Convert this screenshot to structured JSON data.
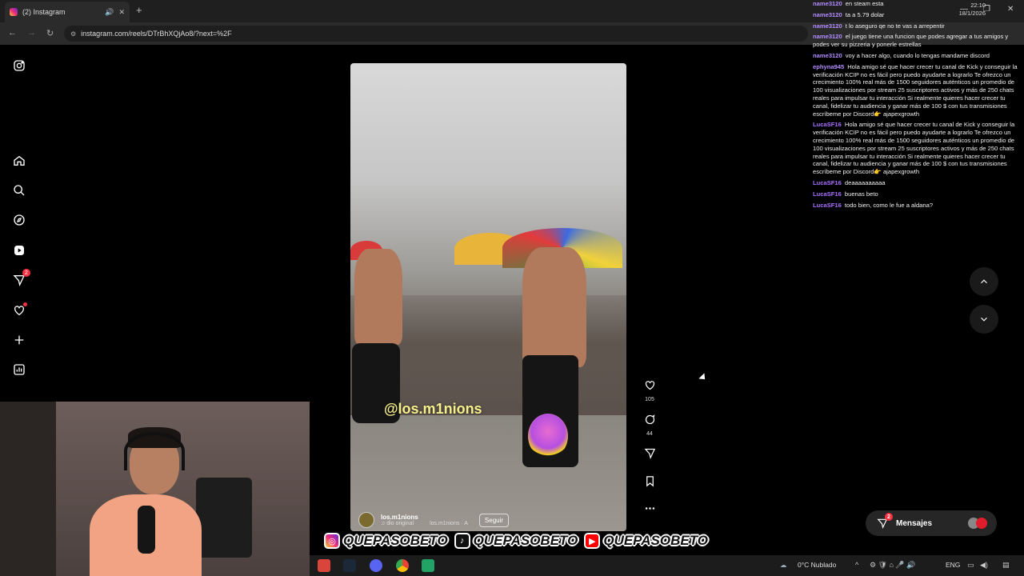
{
  "browser": {
    "tab_title": "(2) Instagram",
    "new_tab": "+",
    "url": "instagram.com/reels/DTrBhXQjAo8/?next=%2F"
  },
  "sidebar": {
    "notifications_badge": "2"
  },
  "reel": {
    "overlay_tag": "@los.m1nions",
    "username": "los.m1nions",
    "audio": "♫ dio original",
    "audio_attribution": "los.m1nions · A",
    "follow_label": "Seguir"
  },
  "actions": {
    "likes": "105",
    "comments": "44"
  },
  "messages": {
    "label": "Mensajes",
    "badge": "2"
  },
  "chat": [
    {
      "name": "name3120",
      "color": "#b38cff",
      "text": "en steam esta"
    },
    {
      "name": "name3120",
      "color": "#b38cff",
      "text": "ta a 5.79 dolar"
    },
    {
      "name": "name3120",
      "color": "#b38cff",
      "text": "t lo aseguro qe no te vas a arrepentir"
    },
    {
      "name": "name3120",
      "color": "#b38cff",
      "text": "el juego tiene una funcion que podes agregar a tus amigos y podes ver su pizzeria y ponerle estrellas"
    },
    {
      "name": "name3120",
      "color": "#b38cff",
      "text": "voy a hacer algo, cuando lo tengas mandame discord"
    },
    {
      "name": "ephyna945",
      "color": "#b38cff",
      "text": "Hola amigo sé que hacer crecer tu canal de Kick y conseguir la verificación KCIP no es fácil pero puedo ayudarte a lograrlo Te ofrezco un crecimiento 100% real más de 1500 seguidores auténticos un promedio de 100 visualizaciones por stream 25 suscriptores activos y más de 250 chats reales para impulsar tu interacción Si realmente quieres hacer crecer tu canal, fidelizar tu audiencia y ganar más de 100 $ con tus transmisiones escríbeme por Discord👉 ajapexgrowth"
    },
    {
      "name": "LucaSF16",
      "color": "#a970ff",
      "text": "Hola amigo sé que hacer crecer tu canal de Kick y conseguir la verificación KCIP no es fácil pero puedo ayudarte a lograrlo Te ofrezco un crecimiento 100% real más de 1500 seguidores auténticos un promedio de 100 visualizaciones por stream 25 suscriptores activos y más de 250 chats reales para impulsar tu interacción Si realmente quieres hacer crecer tu canal, fidelizar tu audiencia y ganar más de 100 $ con tus transmisiones escríbeme por Discord👉 ajapexgrowth"
    },
    {
      "name": "LucaSF16",
      "color": "#a970ff",
      "text": "deaaaaaaaaaa"
    },
    {
      "name": "LucaSF16",
      "color": "#a970ff",
      "text": "buenas beto"
    },
    {
      "name": "LucaSF16",
      "color": "#a970ff",
      "text": "todo bien, como le fue a aldana?"
    }
  ],
  "banner": {
    "handle_1": "QUEPASOBETO",
    "handle_2": "QUEPASOBETO",
    "handle_3": "QUEPASOBETO"
  },
  "taskbar": {
    "weather": "0°C  Nublado",
    "lang": "ENG",
    "time": "22:10",
    "date": "18/1/2026"
  }
}
